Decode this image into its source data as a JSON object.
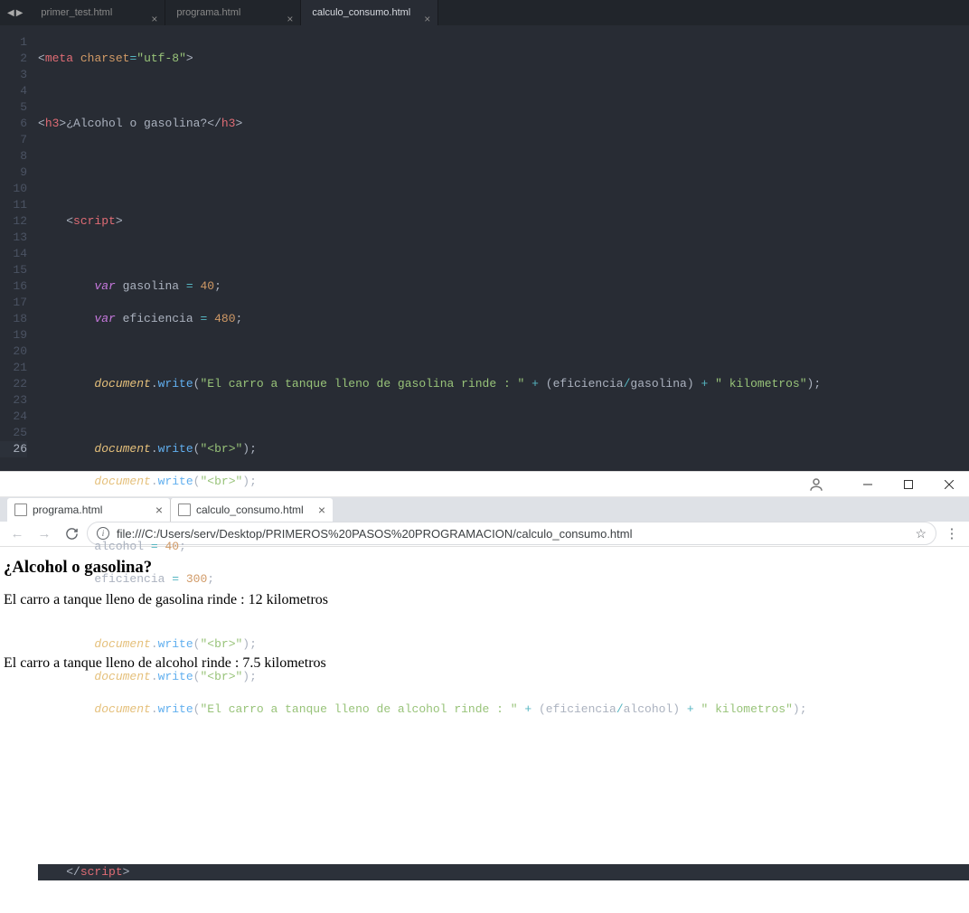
{
  "editor": {
    "tabs": [
      {
        "label": "primer_test.html",
        "active": false
      },
      {
        "label": "programa.html",
        "active": false
      },
      {
        "label": "calculo_consumo.html",
        "active": true
      }
    ],
    "lines": {
      "l1_meta": "meta",
      "l1_charset_attr": "charset",
      "l1_charset_val": "\"utf-8\"",
      "l3_h3": "h3",
      "l3_text": "¿Alcohol o gasolina?",
      "l6_script": "script",
      "l8_var": "var",
      "l8_name": "gasolina",
      "l8_val": "40",
      "l9_var": "var",
      "l9_name": "eficiencia",
      "l9_val": "480",
      "doc": "document",
      "write": "write",
      "l11_str": "\"El carro a tanque lleno de gasolina rinde : \"",
      "l11_a": "eficiencia",
      "l11_b": "gasolina",
      "l11_str2": "\" kilometros\"",
      "br_str": "\"<br>\"",
      "l16_name": "alcohol",
      "l16_val": "40",
      "l17_name": "eficiencia",
      "l17_val": "300",
      "l21_str": "\"El carro a tanque lleno de alcohol rinde : \"",
      "l21_a": "eficiencia",
      "l21_b": "alcohol",
      "l21_str2": "\" kilometros\"",
      "l26_script": "script"
    }
  },
  "browser": {
    "tabs": [
      {
        "label": "programa.html",
        "active": true
      },
      {
        "label": "calculo_consumo.html",
        "active": false
      }
    ],
    "url": "file:///C:/Users/serv/Desktop/PRIMEROS%20PASOS%20PROGRAMACION/calculo_consumo.html",
    "page": {
      "heading": "¿Alcohol o gasolina?",
      "line1": "El carro a tanque lleno de gasolina rinde : 12 kilometros",
      "line2": "El carro a tanque lleno de alcohol rinde : 7.5 kilometros"
    }
  }
}
